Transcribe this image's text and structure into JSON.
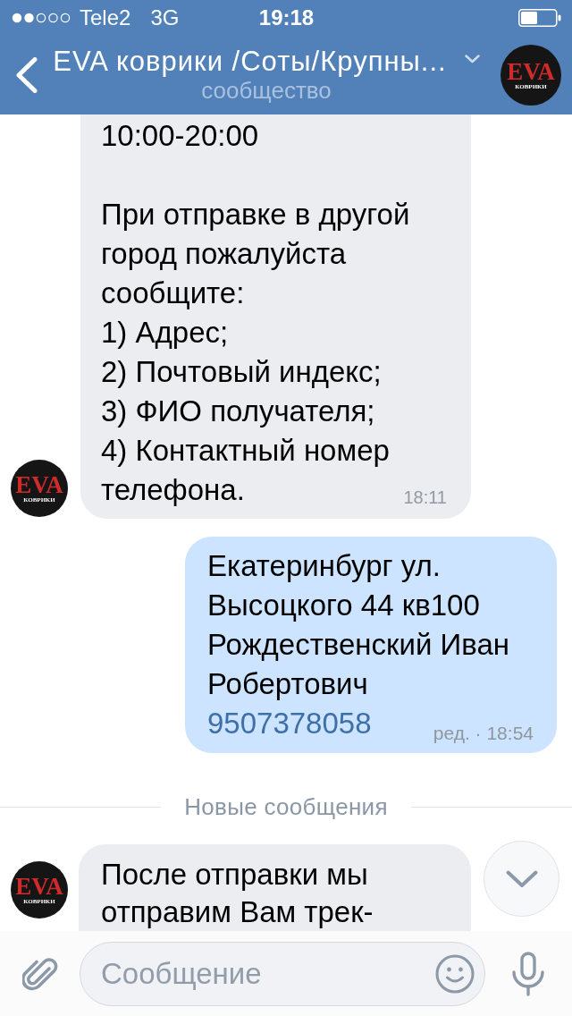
{
  "status_bar": {
    "carrier": "Tele2",
    "network": "3G",
    "time": "19:18"
  },
  "header": {
    "title": "EVA коврики /Соты/Крупны...",
    "subtitle": "сообщество",
    "avatar": {
      "logo": "EVA",
      "caption": "КОВРИКИ"
    }
  },
  "chat": [
    {
      "kind": "incoming",
      "text": "10:00-20:00\n\nПри отправке в другой город пожалуйста сообщите:\n1) Адрес;\n2) Почтовый индекс;\n3) ФИО получателя;\n4) Контактный номер телефона.",
      "time": "18:11",
      "avatar": {
        "logo": "EVA",
        "caption": "КОВРИКИ"
      }
    },
    {
      "kind": "outgoing",
      "text": "Екатеринбург ул. Высоцкого 44 кв100 Рождественский Иван Робертович",
      "link": "9507378058",
      "time": "ред. · 18:54"
    },
    {
      "kind": "divider",
      "label": "Новые сообщения"
    },
    {
      "kind": "incoming",
      "text": "После отправки мы отправим Вам трек-",
      "avatar": {
        "logo": "EVA",
        "caption": "КОВРИКИ"
      }
    }
  ],
  "composer": {
    "placeholder": "Сообщение"
  }
}
